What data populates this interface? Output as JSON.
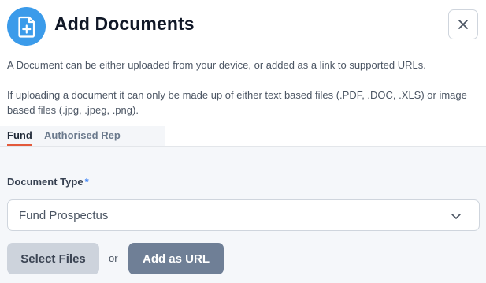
{
  "dialog": {
    "title": "Add Documents",
    "header_icon": "file-plus-icon",
    "close_icon": "close-icon",
    "description_1": "A Document can be either uploaded from your device, or added as a link to supported URLs.",
    "description_2": "If uploading a document it can only be made up of either text based files (.PDF, .DOC, .XLS) or image based files (.jpg, .jpeg, .png)."
  },
  "tabs": [
    {
      "label": "Fund",
      "active": true
    },
    {
      "label": "Authorised Rep",
      "active": false
    }
  ],
  "form": {
    "document_type_label": "Document Type",
    "required_marker": "*",
    "document_type_value": "Fund Prospectus",
    "chevron_icon": "chevron-down-icon"
  },
  "actions": {
    "select_files_label": "Select Files",
    "or_text": "or",
    "add_url_label": "Add as URL"
  },
  "colors": {
    "accent_blue": "#3b9bea",
    "tab_underline": "#e35a3b",
    "required": "#3b82f6",
    "secondary_button": "#cdd3dc",
    "primary_button": "#6f7f96"
  }
}
